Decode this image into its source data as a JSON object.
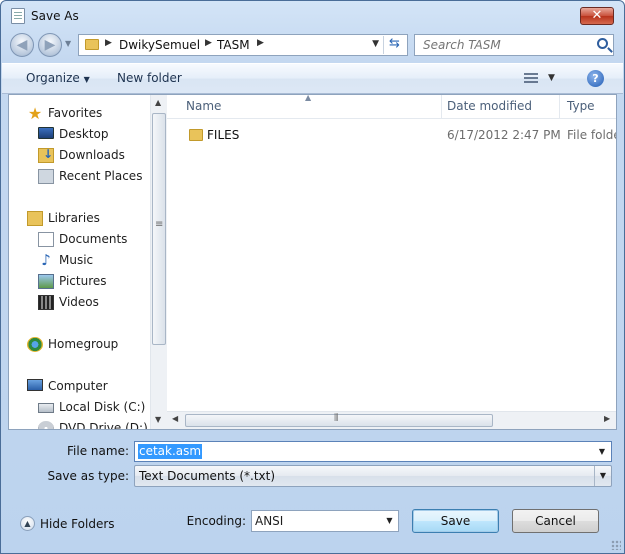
{
  "window": {
    "title": "Save As"
  },
  "title_bar": {
    "close_glyph": "✕"
  },
  "address_bar": {
    "breadcrumbs": [
      "DwikySemuel",
      "TASM"
    ],
    "search_placeholder": "Search TASM"
  },
  "toolbar": {
    "organize_label": "Organize",
    "new_folder_label": "New folder",
    "help_glyph": "?"
  },
  "nav_pane": {
    "favorites_label": "Favorites",
    "favorites": [
      "Desktop",
      "Downloads",
      "Recent Places"
    ],
    "libraries_label": "Libraries",
    "libraries": [
      "Documents",
      "Music",
      "Pictures",
      "Videos"
    ],
    "homegroup_label": "Homegroup",
    "computer_label": "Computer",
    "drives": [
      "Local Disk (C:)",
      "DVD Drive (D:) GR"
    ]
  },
  "columns": {
    "name": "Name",
    "date_modified": "Date modified",
    "type": "Type"
  },
  "files": [
    {
      "name": "FILES",
      "date_modified": "6/17/2012 2:47 PM",
      "type": "File folder"
    }
  ],
  "form": {
    "file_name_label": "File name:",
    "file_name_value": "cetak.asm",
    "save_as_type_label": "Save as type:",
    "save_as_type_value": "Text Documents (*.txt)",
    "encoding_label": "Encoding:",
    "encoding_value": "ANSI"
  },
  "footer": {
    "hide_folders_label": "Hide Folders",
    "save_label": "Save",
    "cancel_label": "Cancel"
  },
  "icons": {
    "app": "notepad-icon",
    "back": "back-arrow-icon",
    "forward": "forward-arrow-icon",
    "refresh": "refresh-icon",
    "search": "search-icon",
    "help": "help-icon",
    "views": "views-icon",
    "folder": "folder-icon"
  },
  "colors": {
    "selection": "#3399ff",
    "close_button": "#c9503b",
    "link_blue": "#2a66b5"
  }
}
